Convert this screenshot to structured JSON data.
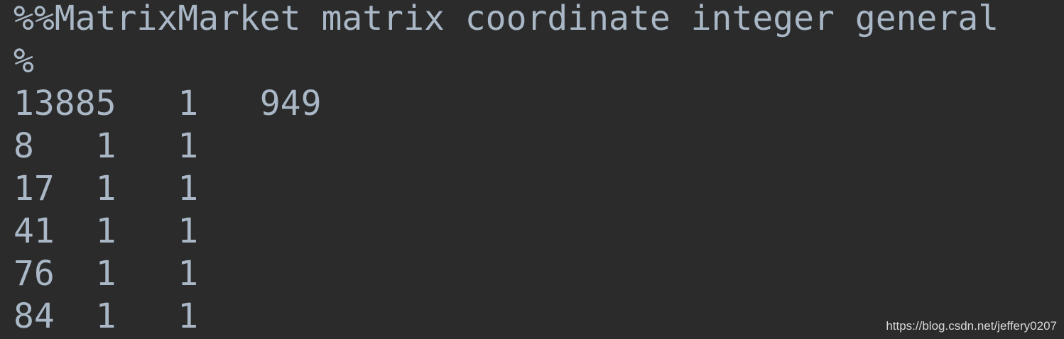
{
  "editor": {
    "lines": [
      "%%MatrixMarket matrix coordinate integer general",
      "%",
      "13885   1   949",
      "8   1   1",
      "17  1   1",
      "41  1   1",
      "76  1   1",
      "84  1   1"
    ]
  },
  "watermark": "https://blog.csdn.net/jeffery0207",
  "colors": {
    "background": "#2b2b2b",
    "text": "#a9b7c6"
  }
}
